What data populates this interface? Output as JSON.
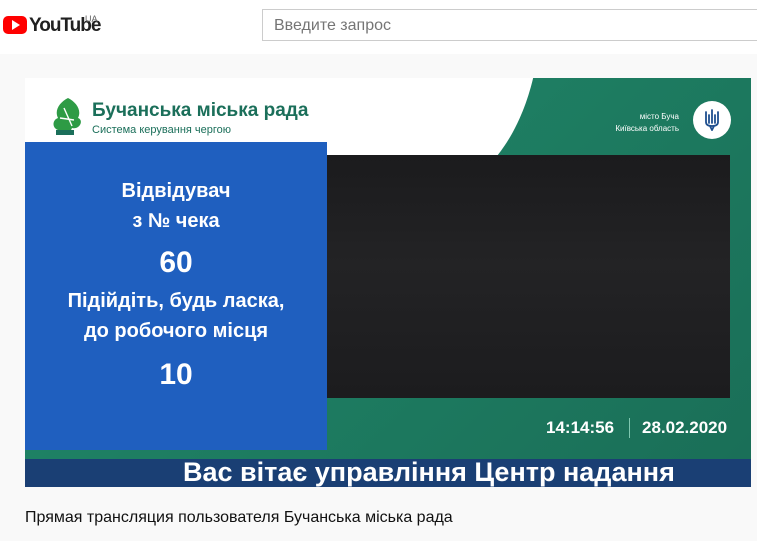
{
  "header": {
    "logo_text": "YouTube",
    "region": "UA",
    "search_placeholder": "Введите запрос"
  },
  "video": {
    "org_title": "Бучанська міська рада",
    "org_subtitle": "Система керування чергою",
    "city_line1": "місто Буча",
    "city_line2": "Київська область",
    "queue": {
      "visitor_label_1": "Відвідувач",
      "visitor_label_2": "з № чека",
      "ticket_number": "60",
      "instruction_1": "Підійдіть, будь ласка,",
      "instruction_2": "до робочого місця",
      "desk_number": "10"
    },
    "time": "14:14:56",
    "date": "28.02.2020",
    "ticker": "Вас вітає управління Центр надання"
  },
  "caption": "Прямая трансляция пользователя Бучанська міська рада",
  "icons": {
    "logo": "youtube-logo-icon",
    "leaf": "leaf-logo-icon",
    "coat": "trident-coat-of-arms-icon"
  }
}
